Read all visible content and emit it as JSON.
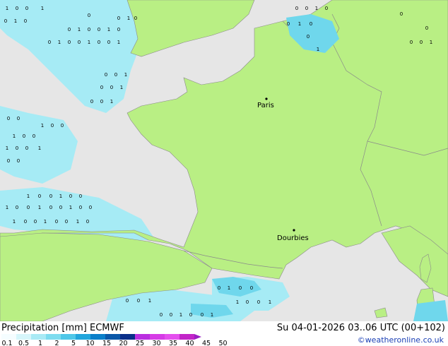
{
  "map": {
    "cities": [
      {
        "name": "Paris"
      },
      {
        "name": "Dourbies"
      }
    ],
    "colors": {
      "land": "#b9ef84",
      "sea": "#e6e6e6",
      "precip_light": "#a6ebf5",
      "precip_mid": "#6fd7ec",
      "precip_heavy": "#3cb6e6",
      "border": "#8a8a8a"
    },
    "grid_values_note_free": true
  },
  "footer": {
    "title_left": "Precipitation [mm]  ECMWF",
    "title_right": "Su 04-01-2026 03..06 UTC (00+102)",
    "credit": "©weatheronline.co.uk"
  },
  "legend": {
    "ticks": [
      "0.1",
      "0.5",
      "1",
      "2",
      "5",
      "10",
      "15",
      "20",
      "25",
      "30",
      "35",
      "40",
      "45",
      "50"
    ],
    "colors": [
      "#f5fdff",
      "#d6f6fb",
      "#a9eaf5",
      "#7ddcef",
      "#4fc7e8",
      "#22a6dc",
      "#0a7fc9",
      "#0a57a8",
      "#0a2f8a",
      "#ba2ee0",
      "#d63ce6",
      "#e44fee",
      "#c225c8",
      "#9b1fc4"
    ]
  }
}
